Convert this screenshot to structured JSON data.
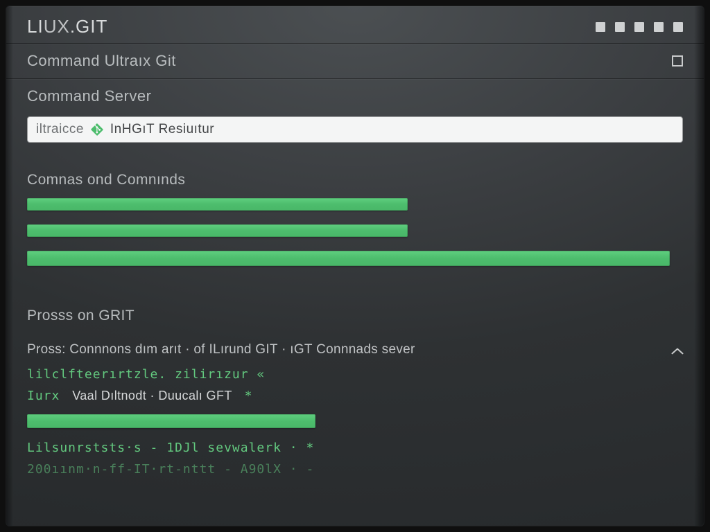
{
  "titlebar": {
    "title_left": "LI",
    "title_mid": "UX",
    "title_dot": ".",
    "title_right": "GIT"
  },
  "section1": {
    "label": "Command Ultraıx Git"
  },
  "section2": {
    "label": "Command Server"
  },
  "input": {
    "pre": "iltraicce",
    "post": "InHGıT Resiuıtur"
  },
  "commands": {
    "heading": "Comnas ond Comnınds",
    "bars": [
      58,
      58,
      98
    ]
  },
  "process": {
    "heading": "Prosss on GRIT",
    "line": "Pross: Connnons dım arıt · of ILırund GIT · ıGT Connnads sever",
    "term1": "lilclfteerırtzle. zilirızur «",
    "term2_pre": "Iurx",
    "term2_mid": "Vaal Dıltnodt · Duucalı GFT",
    "term2_suf": "*",
    "bar": 44,
    "term3": "Lilsunrststs·s - 1DJl sevwalerk · *",
    "term4": "200ıınm·n-ff-IT·rt-nttt - A90lX · -"
  },
  "colors": {
    "accent": "#4dbd6d",
    "text": "#b9bdbf"
  }
}
